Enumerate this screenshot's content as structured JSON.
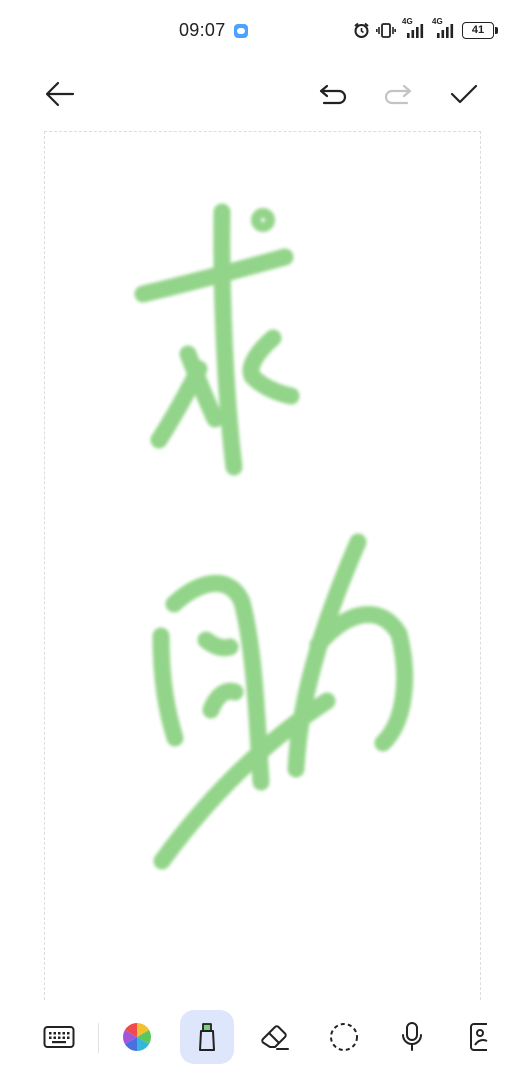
{
  "status_bar": {
    "time": "09:07",
    "network_1": "4G",
    "network_2": "4G",
    "battery": "41"
  },
  "toolbar": {
    "back_icon": "arrow-left-icon",
    "undo_icon": "undo-icon",
    "redo_icon": "redo-icon",
    "redo_enabled": false,
    "done_icon": "check-icon"
  },
  "canvas": {
    "ink_color": "#84cf79",
    "handwritten_text": "求助"
  },
  "bottom_toolbar": {
    "tools": [
      "keyboard-icon",
      "color-palette-icon",
      "highlighter-pen-icon",
      "eraser-icon",
      "lasso-select-icon",
      "microphone-icon",
      "image-insert-icon"
    ],
    "selected_tool": "highlighter-pen-icon",
    "selected_tool_bg": "#dde6fb"
  }
}
